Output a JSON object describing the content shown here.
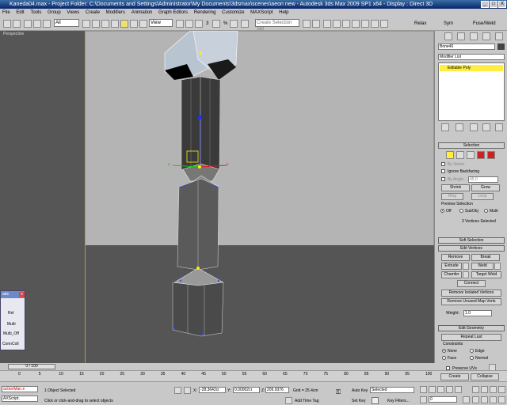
{
  "window": {
    "title": "Kaneda04.max    - Project Folder: C:\\Documents and Settings\\Administrator\\My Documents\\3dsmax\\scenes\\aeon new     - Autodesk 3ds Max  2009 SP1  x64     - Display : Direct 3D",
    "minimize": "_",
    "maximize": "□",
    "close": "X"
  },
  "menu": [
    "File",
    "Edit",
    "Tools",
    "Group",
    "Views",
    "Create",
    "Modifiers",
    "Animation",
    "Graph Editors",
    "Rendering",
    "Customize",
    "MAXScript",
    "Help"
  ],
  "toolbar": {
    "selection_filter": "All",
    "reference_coord": "View",
    "named_selection_placeholder": "Create Selection Set",
    "relax_label": "Relax",
    "sym_label": "Sym",
    "fuseweld_label": "Fuse/Weld",
    "snap_label": "3",
    "angle_label": "%"
  },
  "viewport": {
    "label": "Perspective"
  },
  "float_panel": {
    "title": "abs",
    "items": [
      "Rel",
      "Multi",
      "Multi_Off",
      "ConnColl"
    ]
  },
  "panel": {
    "object_name": "Bone46",
    "modifier_list": "Modifier List",
    "stack_item": "Editable Poly",
    "selection": {
      "title": "Selection",
      "by_vertex": "By Vertex",
      "ignore_backfacing": "Ignore Backfacing",
      "by_angle": "By Angle:",
      "by_angle_value": "45.0",
      "shrink": "Shrink",
      "grow": "Grow",
      "ring": "Ring",
      "loop": "Loop",
      "preview_selection": "Preview Selection",
      "off": "Off",
      "subobj": "SubObj",
      "multi": "Multi",
      "status": "3 Vertices Selected"
    },
    "soft_selection": "Soft Selection",
    "edit_vertices": {
      "title": "Edit Vertices",
      "remove": "Remove",
      "break": "Break",
      "extrude": "Extrude",
      "weld": "Weld",
      "chamfer": "Chamfer",
      "target_weld": "Target Weld",
      "connect": "Connect",
      "remove_isolated": "Remove Isolated Vertices",
      "remove_unused": "Remove Unused Map Verts",
      "weight_label": "Weight:",
      "weight_value": "1.0"
    },
    "edit_geometry": {
      "title": "Edit Geometry",
      "repeat_last": "Repeat Last",
      "constraints": "Constraints",
      "none": "None",
      "edge": "Edge",
      "face": "Face",
      "normal": "Normal",
      "preserve_uvs": "Preserve UVs",
      "create": "Create",
      "collapse": "Collapse"
    }
  },
  "timeline": {
    "frame_counter": "0 / 100",
    "ticks": [
      "0",
      "5",
      "10",
      "15",
      "20",
      "25",
      "30",
      "35",
      "40",
      "45",
      "50",
      "55",
      "60",
      "65",
      "70",
      "75",
      "80",
      "85",
      "90",
      "95",
      "100"
    ]
  },
  "status": {
    "listener_1": "actionMan.e",
    "listener_2": "AXScript.",
    "selected": "1 Object Selected",
    "prompt": "Click or click-and-drag to select objects",
    "x_label": "X:",
    "x_value": "-28.3642cr",
    "y_label": "Y:",
    "y_value": "0.00002cr",
    "z_label": "Z:",
    "z_value": "209.9376",
    "grid": "Grid = 25.4cm",
    "add_time_tag": "Add Time Tag",
    "auto_key": "Auto Key",
    "set_key": "Set Key",
    "key_mode": "Selected",
    "key_filters": "Key Filters...",
    "frame_value": "0"
  }
}
